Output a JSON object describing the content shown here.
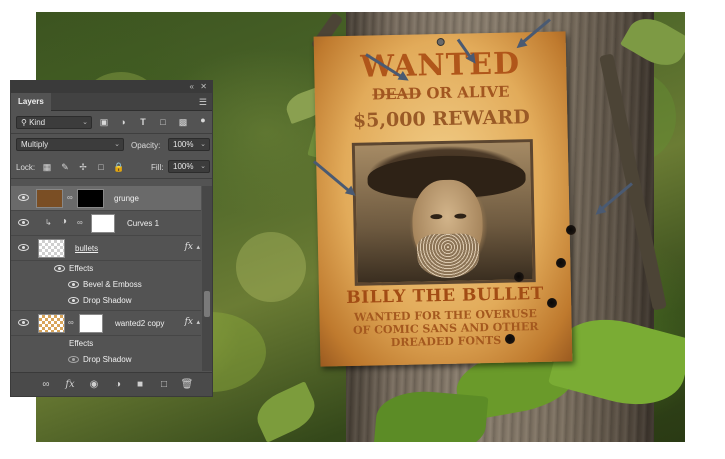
{
  "poster": {
    "title": "WANTED",
    "dead": "DEAD",
    "or_alive": " OR ALIVE",
    "reward": "$5,000 REWARD",
    "name": "BILLY THE BULLET",
    "blurb_line1": "WANTED FOR THE OVERUSE",
    "blurb_line2": "OF COMIC SANS AND OTHER",
    "blurb_line3": "DREADED FONTS"
  },
  "panel": {
    "collapse_icon": "double-chevron-icon",
    "close_icon": "close-icon",
    "tab_label": "Layers",
    "menu_icon": "hamburger-menu-icon",
    "filter_kind": "Kind",
    "blend_mode": "Multiply",
    "opacity_label": "Opacity:",
    "opacity_value": "100%",
    "lock_label": "Lock:",
    "fill_label": "Fill:",
    "fill_value": "100%"
  },
  "layers": [
    {
      "name": "grunge",
      "thumb_color": "#7a4e24",
      "mask_color": "#000000",
      "selected": true
    },
    {
      "name": "Curves 1",
      "type": "adjustment"
    },
    {
      "name": "bullets",
      "fx": "fx",
      "effects_label": "Effects",
      "effects": [
        "Bevel & Emboss",
        "Drop Shadow"
      ]
    },
    {
      "name": "wanted2 copy",
      "fx": "fx",
      "effects_label": "Effects",
      "effects": [
        "Drop Shadow"
      ]
    }
  ],
  "colors": {
    "panel_bg": "#535353",
    "selected_row": "#6a6a6a",
    "arrow": "#4a5a72",
    "poster_ink": "#a45a1a"
  }
}
